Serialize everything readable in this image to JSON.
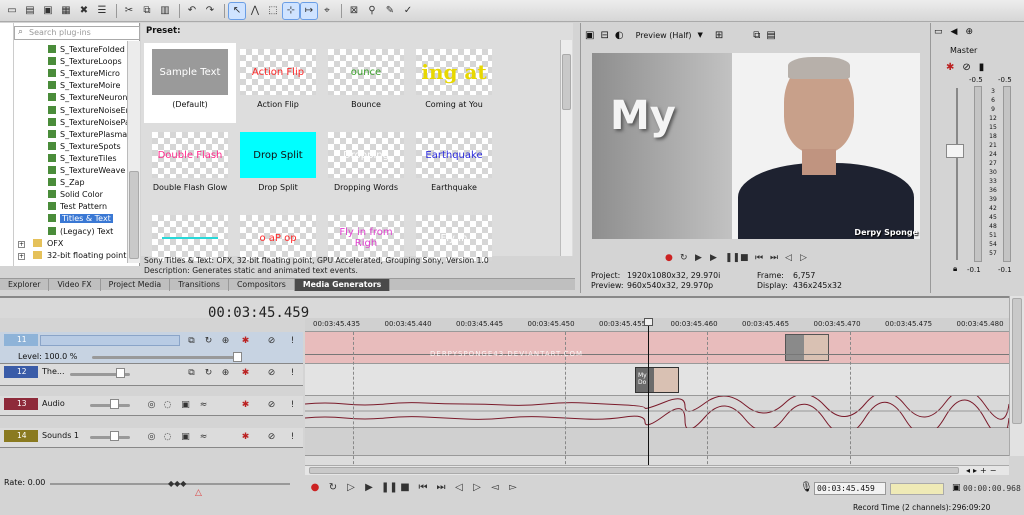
{
  "toolbar": {
    "icons": [
      "new-icon",
      "open-icon",
      "save-icon",
      "save-as-icon",
      "render-icon",
      "properties-icon",
      "cut-icon",
      "copy-icon",
      "paste-icon",
      "undo-icon",
      "redo-icon",
      "normal-edit-tool-icon",
      "envelope-tool-icon",
      "selection-tool-icon",
      "snapping-icon",
      "auto-ripple-icon",
      "lock-envelopes-icon",
      "ignore-grouping-icon",
      "zoom-icon",
      "marker-icon",
      "options-icon"
    ]
  },
  "explorer": {
    "search_placeholder": "Search plug-ins",
    "items": [
      {
        "label": "S_TextureFolded",
        "type": "plugin"
      },
      {
        "label": "S_TextureLoops",
        "type": "plugin"
      },
      {
        "label": "S_TextureMicro",
        "type": "plugin"
      },
      {
        "label": "S_TextureMoire",
        "type": "plugin"
      },
      {
        "label": "S_TextureNeurons",
        "type": "plugin"
      },
      {
        "label": "S_TextureNoiseEmb",
        "type": "plugin"
      },
      {
        "label": "S_TextureNoisePain",
        "type": "plugin"
      },
      {
        "label": "S_TexturePlasma",
        "type": "plugin"
      },
      {
        "label": "S_TextureSpots",
        "type": "plugin"
      },
      {
        "label": "S_TextureTiles",
        "type": "plugin"
      },
      {
        "label": "S_TextureWeave",
        "type": "plugin"
      },
      {
        "label": "S_Zap",
        "type": "plugin"
      },
      {
        "label": "Solid Color",
        "type": "plugin"
      },
      {
        "label": "Test Pattern",
        "type": "plugin"
      },
      {
        "label": "Titles & Text",
        "type": "plugin",
        "selected": true
      },
      {
        "label": "(Legacy) Text",
        "type": "plugin"
      },
      {
        "label": "OFX",
        "type": "folder"
      },
      {
        "label": "32-bit floating point",
        "type": "folder"
      }
    ]
  },
  "presets": {
    "title": "Preset:",
    "items": [
      {
        "label": "(Default)",
        "sample": "Sample Text",
        "color": "#ffffff",
        "bg": "#9a9a9a",
        "selected": true
      },
      {
        "label": "Action Flip",
        "sample": "Action Flip",
        "color": "#ff2a2a",
        "bg": ""
      },
      {
        "label": "Bounce",
        "sample": "ounce",
        "color": "#3aa02a",
        "bg": ""
      },
      {
        "label": "Coming at You",
        "sample": "ing at",
        "color": "#e8d800",
        "bg": ""
      },
      {
        "label": "Double Flash Glow",
        "sample": "Double Flash",
        "color": "#ff2a8c",
        "bg": ""
      },
      {
        "label": "Drop Split",
        "sample": "Drop Split",
        "color": "#111111",
        "bg": "#00ffff"
      },
      {
        "label": "Dropping Words",
        "sample": "Dropping",
        "color": "#ffffff",
        "bg": ""
      },
      {
        "label": "Earthquake",
        "sample": "Earthquake",
        "color": "#2a2adc",
        "bg": ""
      },
      {
        "label": "",
        "sample": "",
        "color": "#2ad8d8",
        "bg": ""
      },
      {
        "label": "",
        "sample": "o aP op",
        "color": "#ff2a2a",
        "bg": ""
      },
      {
        "label": "",
        "sample": "Fly in from Righ",
        "color": "#e040d0",
        "bg": ""
      },
      {
        "label": "",
        "sample": "Fly In",
        "color": "#ffffff",
        "bg": ""
      }
    ],
    "description_line1": "Sony Titles & Text: OFX, 32-bit floating point, GPU Accelerated, Grouping Sony, Version 1.0",
    "description_line2": "Description: Generates static and animated text events."
  },
  "tabs": [
    "Explorer",
    "Video FX",
    "Project Media",
    "Transitions",
    "Compositors",
    "Media Generators"
  ],
  "active_tab": "Media Generators",
  "preview": {
    "quality": "Preview (Half)",
    "video_text": "My",
    "overlay_name": "Derpy Sponge",
    "project_label": "Project:",
    "project_value": "1920x1080x32, 29.970i",
    "preview_label": "Preview:",
    "preview_value": "960x540x32, 29.970p",
    "frame_label": "Frame:",
    "frame_value": "6,757",
    "display_label": "Display:",
    "display_value": "436x245x32"
  },
  "mixer": {
    "title": "Master",
    "peak_left": "-0.5",
    "peak_right": "-0.5",
    "scale": [
      "3",
      "6",
      "9",
      "12",
      "15",
      "18",
      "21",
      "24",
      "27",
      "30",
      "33",
      "36",
      "39",
      "42",
      "45",
      "48",
      "51",
      "54",
      "57"
    ],
    "bottom_left": "-0.1",
    "bottom_right": "-0.1"
  },
  "timeline": {
    "timecode": "00:03:45.459",
    "ruler": [
      "00:03:45.435",
      "00:03:45.440",
      "00:03:45.445",
      "00:03:45.450",
      "00:03:45.455",
      "00:03:45.460",
      "00:03:45.465",
      "00:03:45.470",
      "00:03:45.475",
      "00:03:45.480"
    ],
    "watermark": "DERPYSPONGE43.DEVIANTART.COM",
    "tracks": [
      {
        "num": "11",
        "name": "",
        "type": "video",
        "color": "#8eb3d8",
        "level_label": "Level: 100.0 %"
      },
      {
        "num": "12",
        "name": "The...",
        "type": "video",
        "color": "#3a5ca8"
      },
      {
        "num": "13",
        "name": "Audio",
        "type": "audio",
        "color": "#8e2a3a"
      },
      {
        "num": "14",
        "name": "Sounds 1",
        "type": "audio",
        "color": "#8a7a20"
      }
    ],
    "clip_text": "My Do",
    "rate_label": "Rate: 0.00",
    "cursor_time": "00:03:45.459",
    "selection_length": "00:00:00.968",
    "record_time_label": "Record Time (2 channels):",
    "record_time_value": "296:09:20"
  }
}
